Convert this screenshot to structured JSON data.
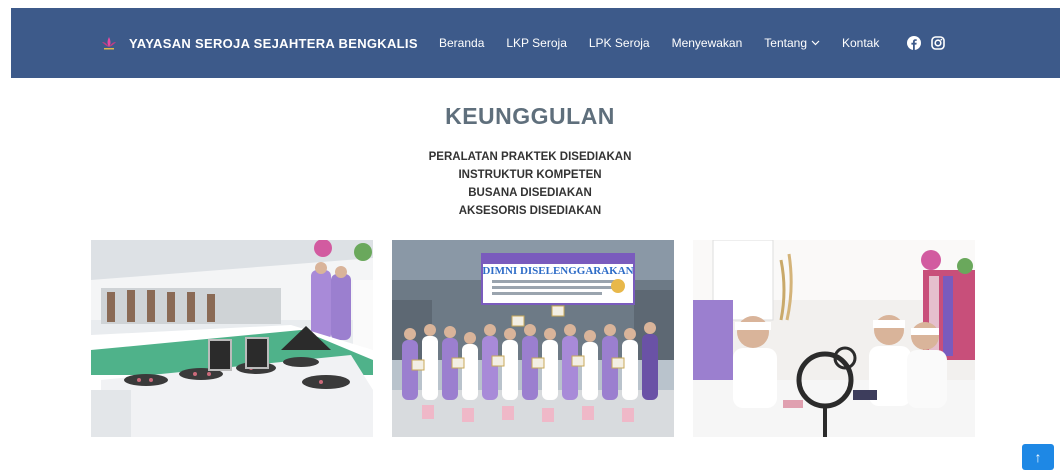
{
  "brand": {
    "name": "YAYASAN SEROJA SEJAHTERA BENGKALIS",
    "logo_icon": "lotus-logo-icon"
  },
  "nav": {
    "items": [
      {
        "label": "Beranda"
      },
      {
        "label": "LKP Seroja"
      },
      {
        "label": "LPK Seroja"
      },
      {
        "label": "Menyewakan"
      },
      {
        "label": "Tentang",
        "dropdown": true
      },
      {
        "label": "Kontak"
      }
    ],
    "social": [
      "facebook-icon",
      "instagram-icon"
    ]
  },
  "section": {
    "title": "KEUNGGULAN",
    "features": [
      "PERALATAN PRAKTEK DISEDIAKAN",
      "INSTRUKTUR KOMPETEN",
      "BUSANA DISEDIAKAN",
      "AKSESORIS DISEDIAKAN"
    ],
    "banner_text": "DIMNI DISELENGGARAKAN"
  },
  "back_to_top": {
    "icon": "arrow-up-icon",
    "glyph": "↑"
  },
  "colors": {
    "navbar": "#3d5a8a",
    "heading": "#5f6f7c",
    "accent": "#1e88e5",
    "lilac": "#9b7fcf"
  }
}
